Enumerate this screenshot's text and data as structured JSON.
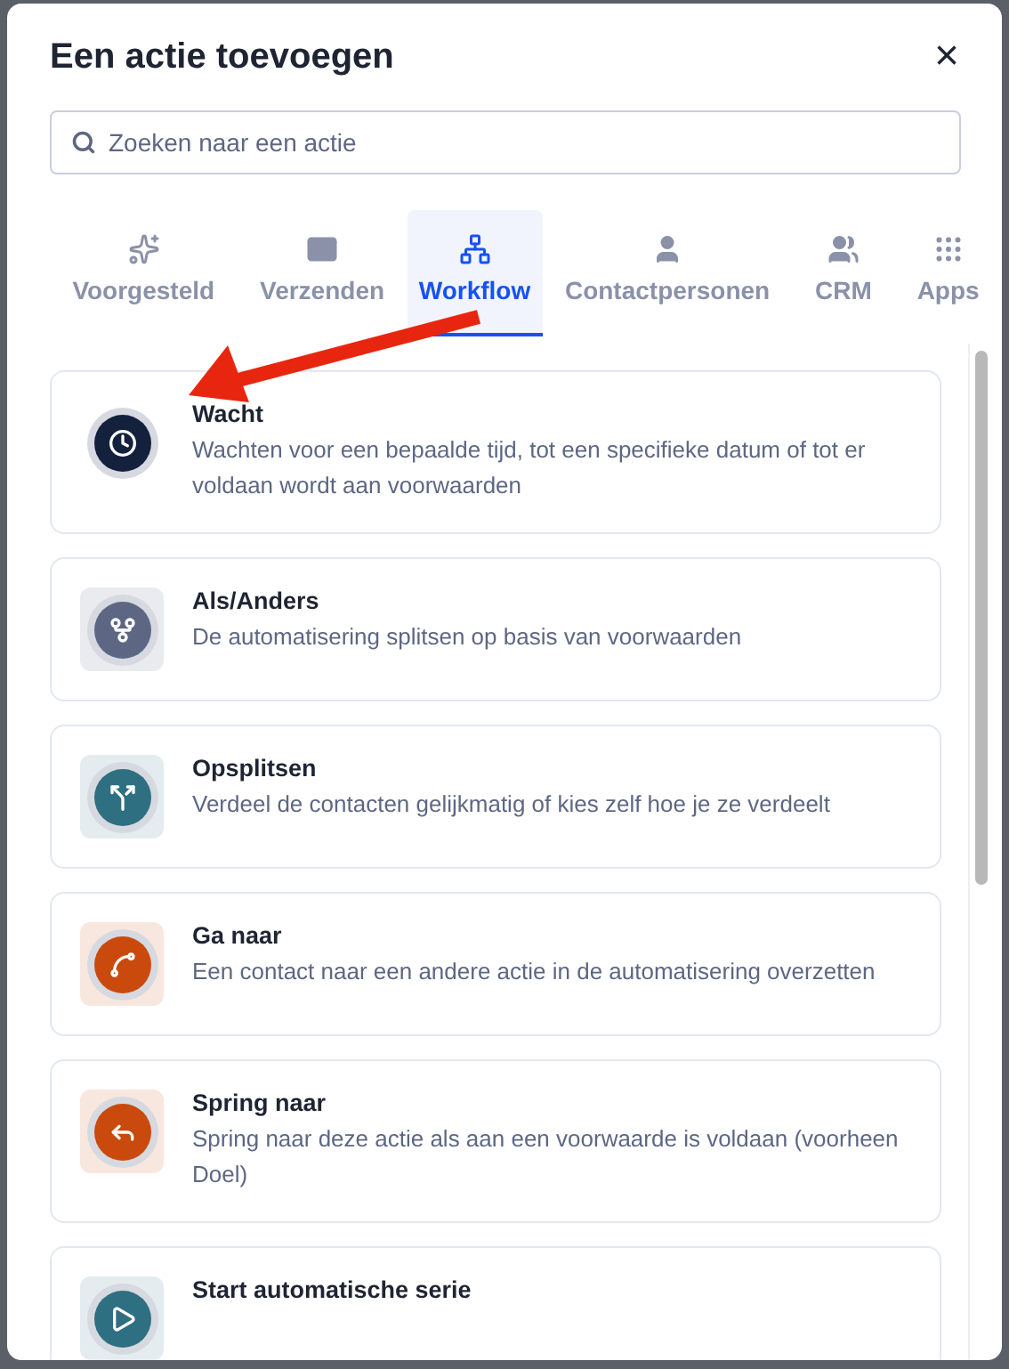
{
  "dialog": {
    "title": "Een actie toevoegen",
    "close": "×"
  },
  "search": {
    "placeholder": "Zoeken naar een actie"
  },
  "tabs": [
    {
      "label": "Voorgesteld",
      "selected": false
    },
    {
      "label": "Verzenden",
      "selected": false
    },
    {
      "label": "Workflow",
      "selected": true
    },
    {
      "label": "Contactpersonen",
      "selected": false
    },
    {
      "label": "CRM",
      "selected": false
    },
    {
      "label": "Apps",
      "selected": false
    }
  ],
  "actions": [
    {
      "kind": "clock",
      "title": "Wacht",
      "description": "Wachten voor een bepaalde tijd, tot een specifieke datum of tot er voldaan wordt aan voorwaarden",
      "color": "#14213d",
      "tile": false
    },
    {
      "kind": "branch",
      "title": "Als/Anders",
      "description": "De automatisering splitsen op basis van voorwaarden",
      "color": "#5d6783",
      "tile": true
    },
    {
      "kind": "split",
      "title": "Opsplitsen",
      "description": "Verdeel de contacten gelijkmatig of kies zelf hoe je ze verdeelt",
      "color": "#2e6f82",
      "tile": true
    },
    {
      "kind": "goto",
      "title": "Ga naar",
      "description": "Een contact naar een andere actie in de automatisering overzetten",
      "color": "#c94a0c",
      "tile": true
    },
    {
      "kind": "jump",
      "title": "Spring naar",
      "description": "Spring naar deze actie als aan een voorwaarde is voldaan (voorheen Doel)",
      "color": "#c94a0c",
      "tile": true
    },
    {
      "kind": "series",
      "title": "Start automatische serie",
      "color": "#2e6f82",
      "tile": true
    }
  ]
}
